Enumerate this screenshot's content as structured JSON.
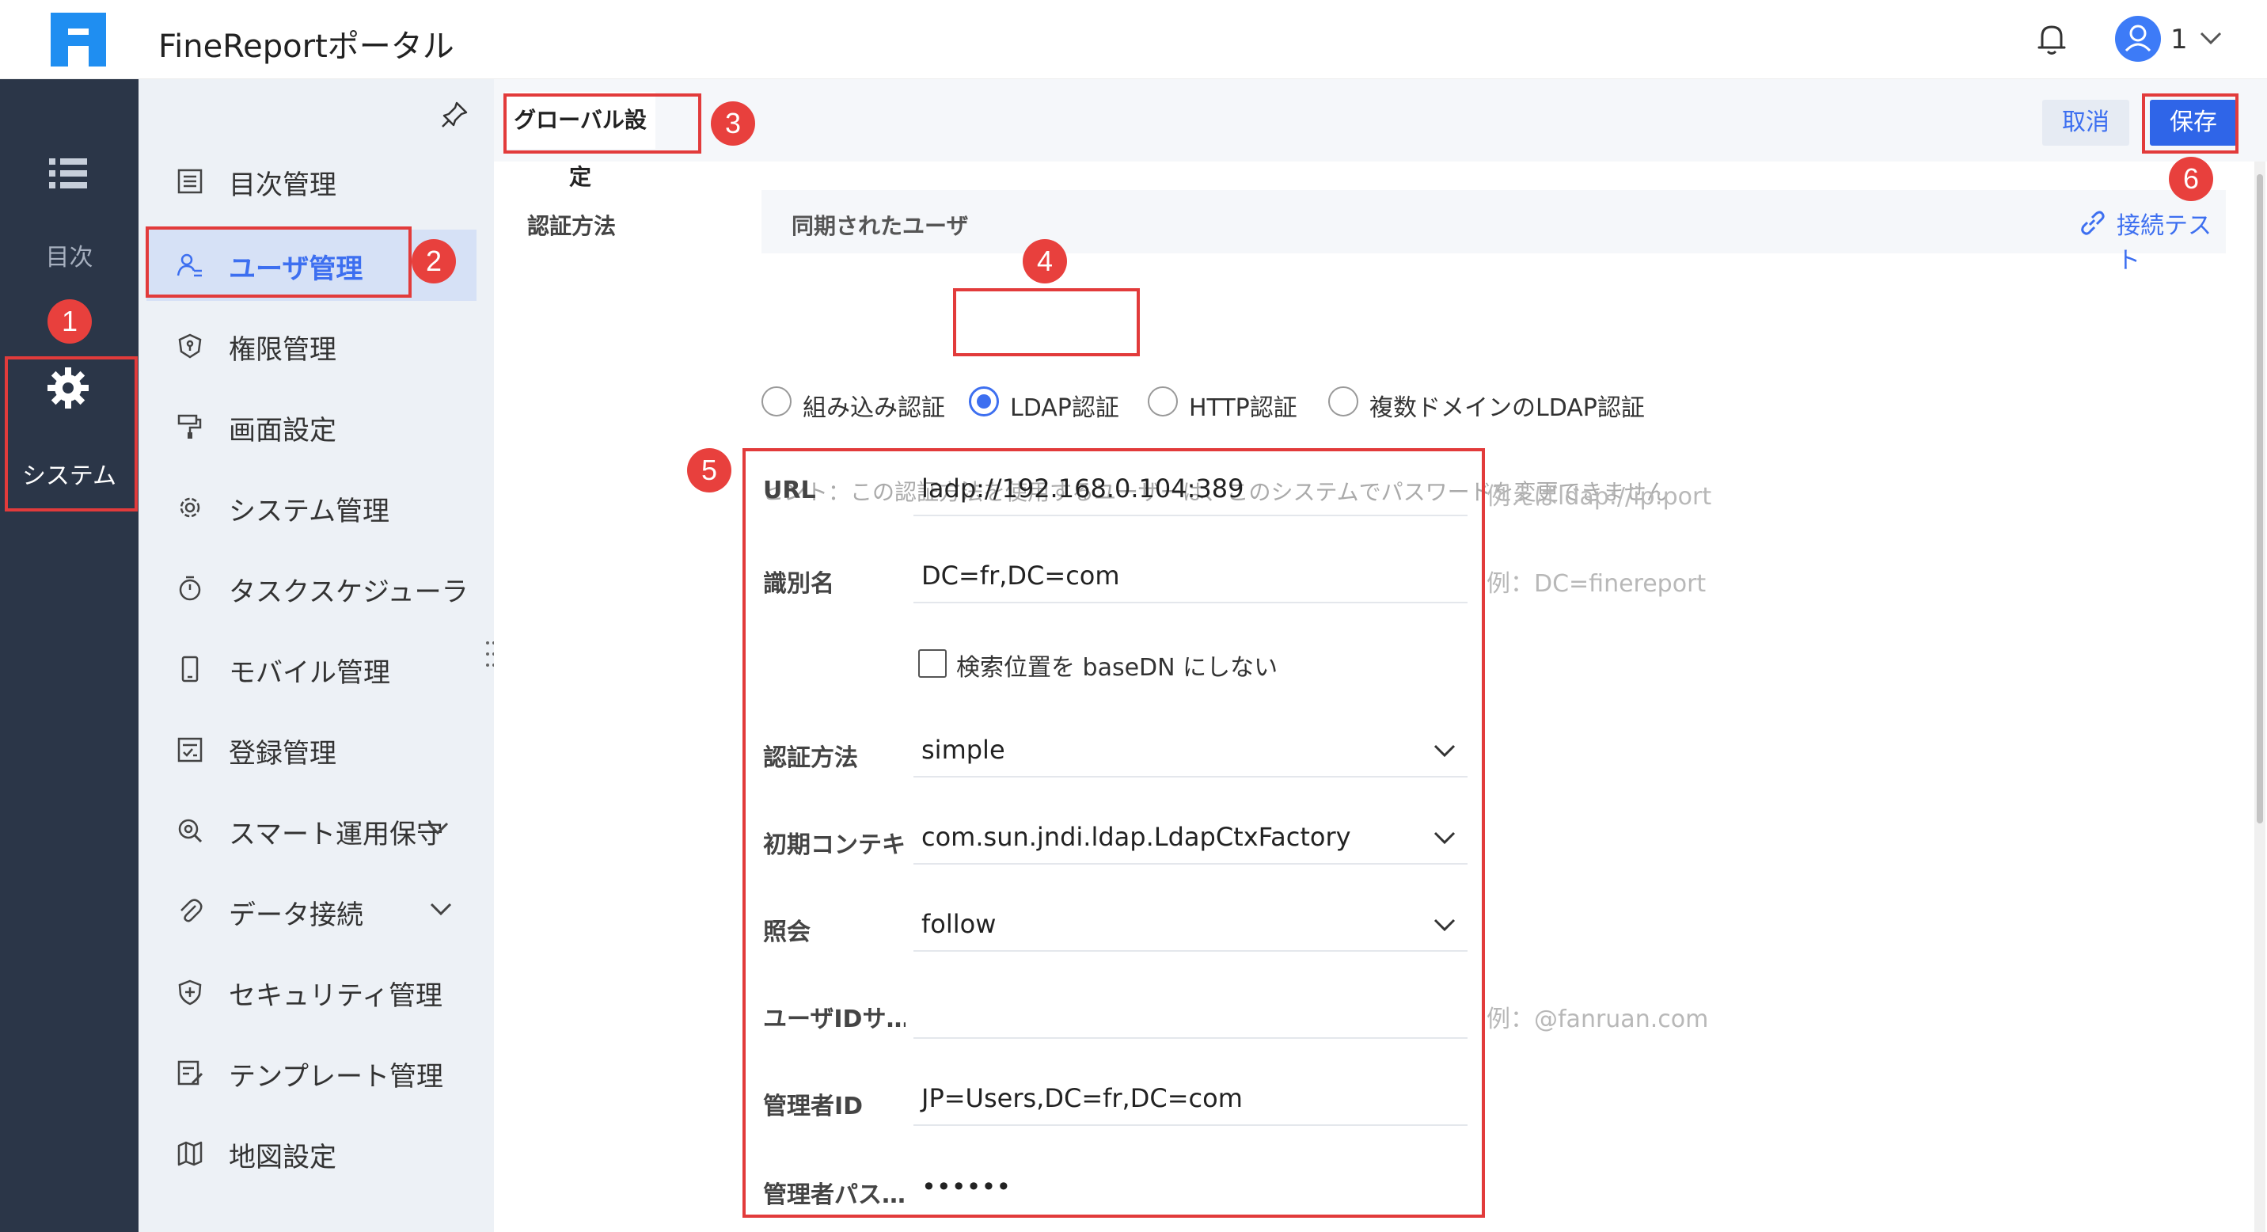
{
  "header": {
    "app_title": "FineReportポータル",
    "user_label": "1"
  },
  "rail": {
    "catalog_label": "目次",
    "system_label": "システム"
  },
  "sidebar": {
    "items": [
      {
        "label": "目次管理",
        "icon": "catalog-icon"
      },
      {
        "label": "ユーザ管理",
        "icon": "user-icon",
        "active": true
      },
      {
        "label": "権限管理",
        "icon": "permission-icon"
      },
      {
        "label": "画面設定",
        "icon": "appearance-icon"
      },
      {
        "label": "システム管理",
        "icon": "system-gear-icon"
      },
      {
        "label": "タスクスケジューラ",
        "icon": "timer-icon"
      },
      {
        "label": "モバイル管理",
        "icon": "mobile-icon"
      },
      {
        "label": "登録管理",
        "icon": "register-icon"
      },
      {
        "label": "スマート運用保守",
        "icon": "maintenance-icon",
        "expandable": true
      },
      {
        "label": "データ接続",
        "icon": "paperclip-icon",
        "expandable": true
      },
      {
        "label": "セキュリティ管理",
        "icon": "shield-icon"
      },
      {
        "label": "テンプレート管理",
        "icon": "template-icon"
      },
      {
        "label": "地図設定",
        "icon": "map-icon"
      }
    ]
  },
  "toolbar": {
    "tab_label": "グローバル設定",
    "cancel_label": "取消",
    "save_label": "保存"
  },
  "auth": {
    "section_label": "認証方法",
    "sync_label": "同期されたユーザ",
    "connection_test_label": "接続テスト",
    "options": [
      {
        "label": "組み込み認証",
        "selected": false
      },
      {
        "label": "LDAP認証",
        "selected": true
      },
      {
        "label": "HTTP認証",
        "selected": false
      },
      {
        "label": "複数ドメインのLDAP認証",
        "selected": false
      }
    ],
    "hint": "ヒント：この認証方法を使用するユーザーは、このシステムでパスワードを変更できません"
  },
  "ldap_form": {
    "url": {
      "label": "URL",
      "value": "ladp://192.168.0.104:389",
      "example": "例えばldap://ip:port"
    },
    "dn": {
      "label": "識別名",
      "value": "DC=fr,DC=com",
      "example": "例：DC=finereport"
    },
    "search_checkbox": {
      "label": "検索位置を baseDN にしない",
      "checked": false
    },
    "auth_method": {
      "label": "認証方法",
      "value": "simple"
    },
    "initial_context": {
      "label": "初期コンテキ…",
      "value": "com.sun.jndi.ldap.LdapCtxFactory"
    },
    "referral": {
      "label": "照会",
      "value": "follow"
    },
    "user_id_suffix": {
      "label": "ユーザIDサ…",
      "value": "",
      "example": "例：@fanruan.com"
    },
    "admin_id": {
      "label": "管理者ID",
      "value": "JP=Users,DC=fr,DC=com"
    },
    "admin_password": {
      "label": "管理者パス…",
      "value": "••••••"
    }
  },
  "annotations": [
    "1",
    "2",
    "3",
    "4",
    "5",
    "6"
  ],
  "colors": {
    "accent": "#3d6ff0",
    "rail_bg": "#2b3648",
    "sidebar_bg": "#edf1f6",
    "annotation_red": "#e23b3b"
  }
}
